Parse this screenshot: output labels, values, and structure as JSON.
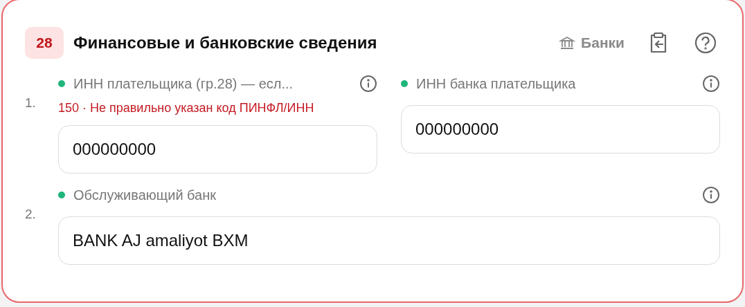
{
  "section": {
    "number": "28",
    "title": "Финансовые и банковские сведения",
    "banks_button": "Банки"
  },
  "rows": [
    {
      "number": "1.",
      "fields": [
        {
          "label": "ИНН плательщика (гр.28) — есл...",
          "color": "#1fb57a",
          "error": "150 · Не правильно указан код ПИНФЛ/ИНН",
          "value": "000000000"
        },
        {
          "label": "ИНН банка плательщика",
          "color": "#1fb57a",
          "value": "000000000"
        }
      ]
    },
    {
      "number": "2.",
      "fields": [
        {
          "label": "Обслуживающий банк",
          "color": "#1fb57a",
          "value": "BANK AJ amaliyot BXM"
        }
      ]
    }
  ]
}
